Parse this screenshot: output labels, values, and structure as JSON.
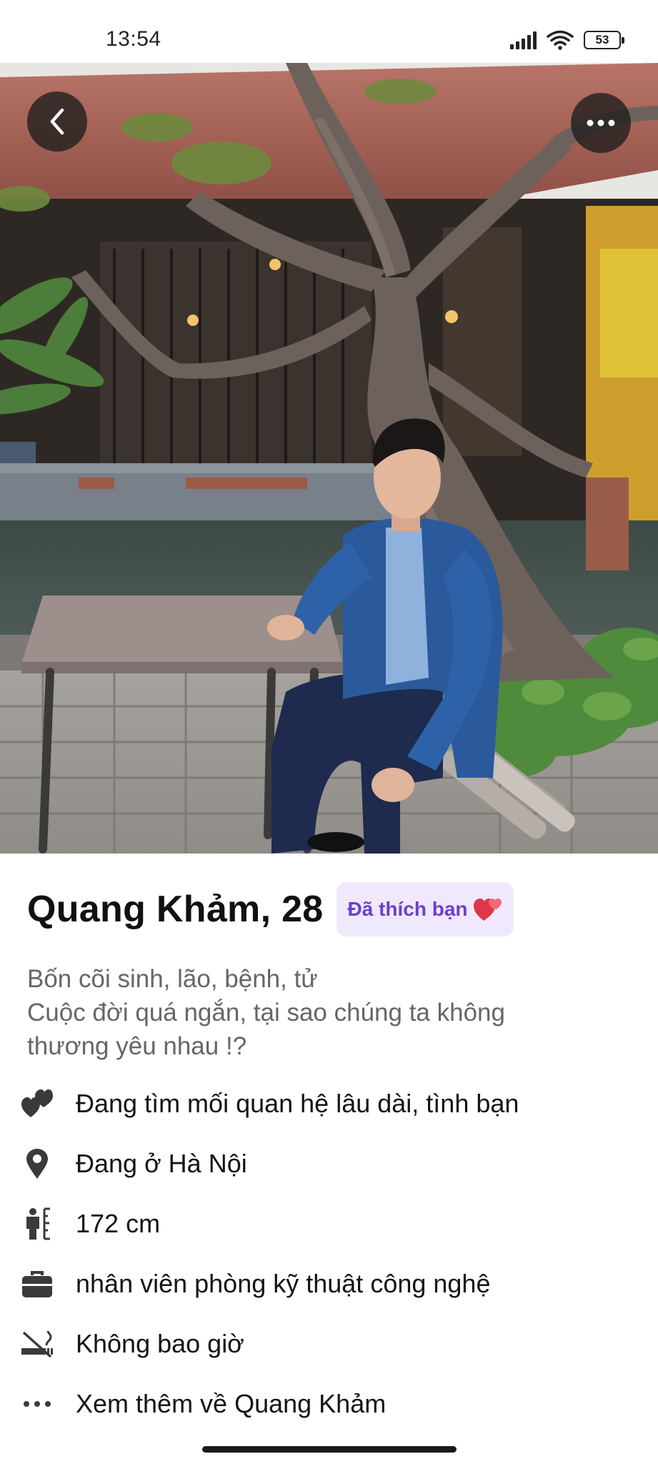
{
  "status_bar": {
    "time": "13:54",
    "battery": "53",
    "icons": [
      "signal-icon",
      "wifi-icon",
      "battery-icon"
    ]
  },
  "photo": {
    "description_icon": "profile-photo",
    "back_icon": "chevron-left-icon",
    "more_icon": "more-horizontal-icon"
  },
  "profile": {
    "name_age": "Quang Khảm, 28",
    "liked_badge": "Đã thích bạn",
    "bio_lines": [
      "Bốn cõi sinh, lão, bệnh, tử",
      "Cuộc đời quá ngắn, tại sao chúng ta không",
      "thương yêu nhau !?"
    ],
    "details": [
      {
        "icon": "hearts-icon",
        "text": "Đang tìm mối quan hệ lâu dài, tình bạn"
      },
      {
        "icon": "location-pin-icon",
        "text": "Đang ở Hà Nội"
      },
      {
        "icon": "height-icon",
        "text": "172 cm"
      },
      {
        "icon": "briefcase-icon",
        "text": "nhân viên phòng kỹ thuật công nghệ"
      },
      {
        "icon": "smoking-icon",
        "text": "Không bao giờ"
      },
      {
        "icon": "more-dots-icon",
        "text": "Xem thêm về Quang Khảm"
      }
    ]
  },
  "colors": {
    "badge_bg": "#f0e9fd",
    "badge_text": "#6a3fd0",
    "icon": "#3a3a3a"
  }
}
